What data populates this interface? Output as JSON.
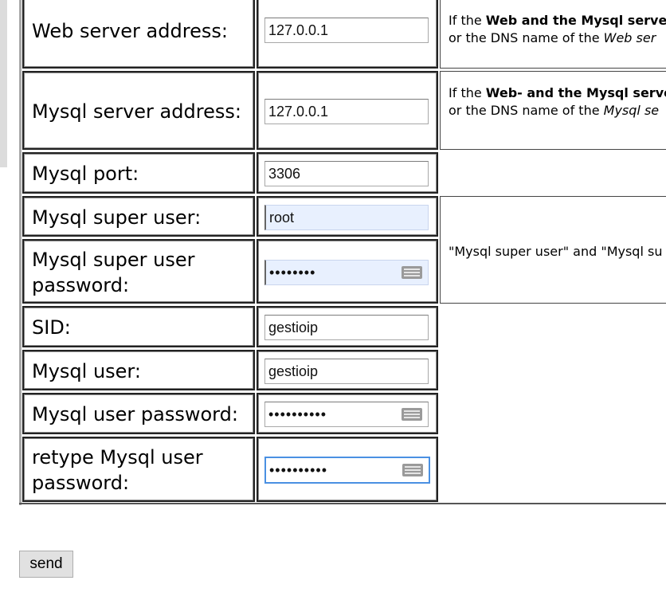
{
  "form": {
    "web_server_address": {
      "label": "Web server address:",
      "value": "127.0.0.1",
      "help_pre": "If the ",
      "help_bold": "Web and the Mysql server",
      "help_line2_pre": "or the DNS name of the ",
      "help_line2_italic": "Web ser"
    },
    "mysql_server_address": {
      "label": "Mysql server address:",
      "value": "127.0.0.1",
      "help_pre": "If the ",
      "help_bold": "Web- and the Mysql serve",
      "help_line2_pre": "or the DNS name of the ",
      "help_line2_italic": "Mysql se"
    },
    "mysql_port": {
      "label": "Mysql port:",
      "value": "3306"
    },
    "mysql_super_user": {
      "label": "Mysql super user:",
      "value": "root"
    },
    "mysql_super_user_password": {
      "label_line1": "Mysql super user",
      "label_line2": "password:",
      "value": "••••••••"
    },
    "super_user_help": "\"Mysql super user\" and \"Mysql su",
    "sid": {
      "label": "SID:",
      "value": "gestioip"
    },
    "mysql_user": {
      "label": "Mysql user:",
      "value": "gestioip"
    },
    "mysql_user_password": {
      "label": "Mysql user password:",
      "value": "••••••••••"
    },
    "retype_mysql_user_password": {
      "label_line1": "retype Mysql user",
      "label_line2": "password:",
      "value": "••••••••••"
    }
  },
  "send_label": "send"
}
